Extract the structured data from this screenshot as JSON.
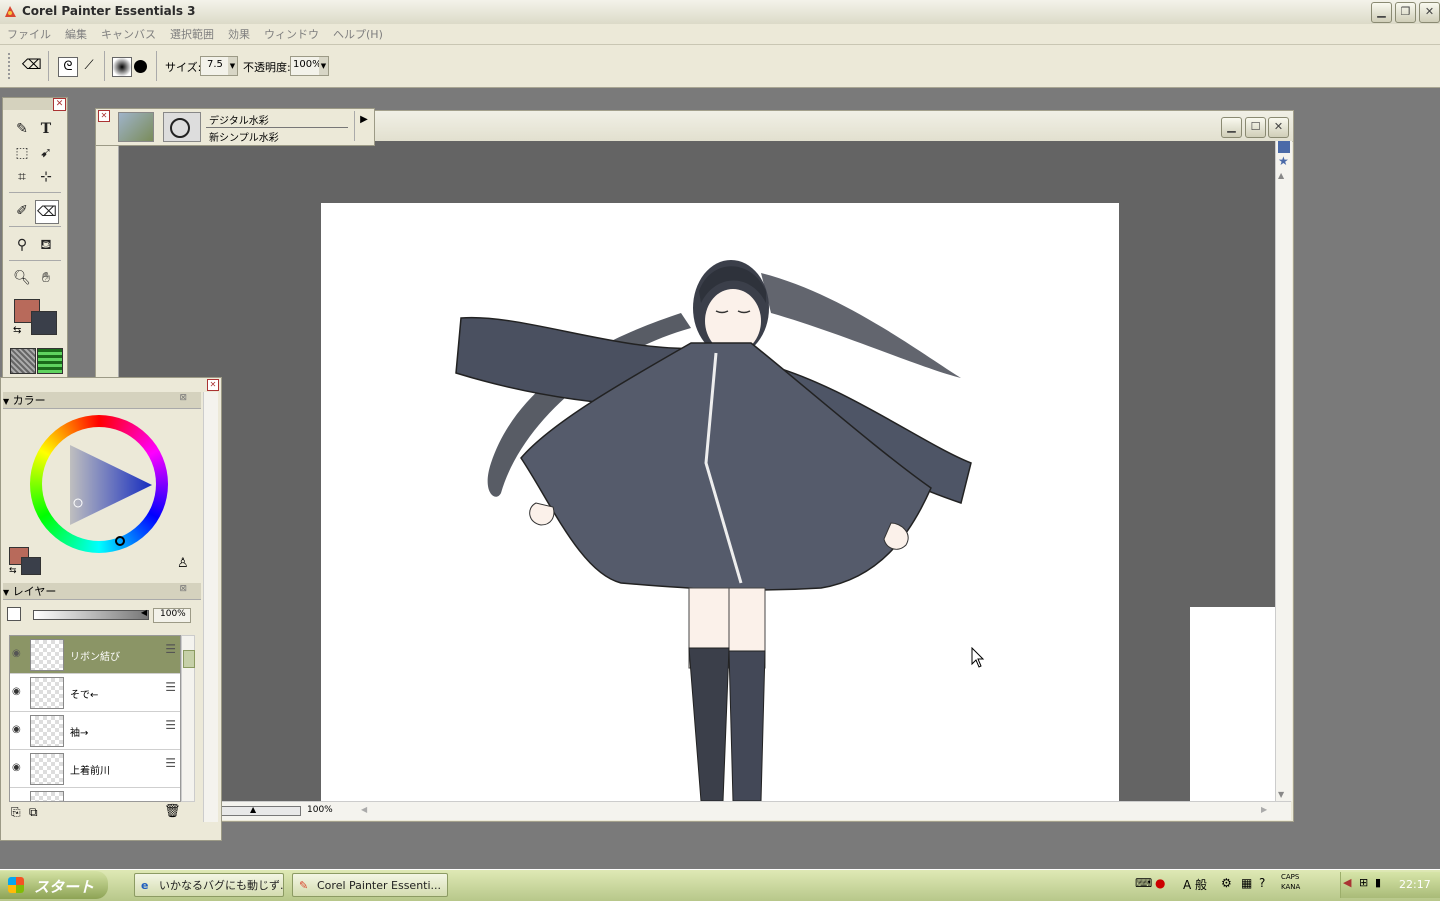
{
  "app": {
    "title": "Corel Painter Essentials 3"
  },
  "menu": [
    "ファイル",
    "編集",
    "キャンバス",
    "選択範囲",
    "効果",
    "ウィンドウ",
    "ヘルプ(H)"
  ],
  "propbar": {
    "size_label": "サイズ:",
    "size_value": "7.5",
    "opacity_label": "不透明度:",
    "opacity_value": "100%"
  },
  "brush": {
    "category": "デジタル水彩",
    "variant": "新シンプル水彩"
  },
  "color_panel": {
    "title": "カラー",
    "main_color": "#b86a5b",
    "secondary_color": "#3a3f4a"
  },
  "layers_panel": {
    "title": "レイヤー",
    "opacity": "100%",
    "items": [
      {
        "name": "リボン結び",
        "selected": true
      },
      {
        "name": "そで←",
        "selected": false
      },
      {
        "name": "袖→",
        "selected": false
      },
      {
        "name": "上着前川",
        "selected": false
      }
    ]
  },
  "document": {
    "zoom": "100%"
  },
  "taskbar": {
    "start_label": "スタート",
    "tasks": [
      "いかなるバグにも動じず...",
      "Corel Painter Essenti..."
    ],
    "ime": "A 般",
    "caps": "CAPS",
    "kana": "KANA",
    "clock": "22:17"
  }
}
